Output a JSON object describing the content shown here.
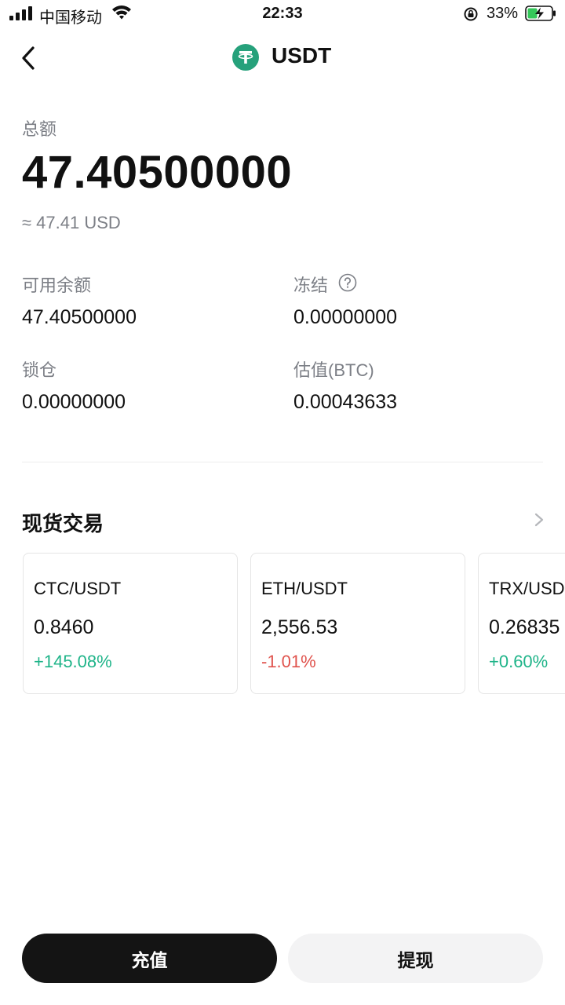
{
  "status_bar": {
    "carrier": "中国移动",
    "time": "22:33",
    "battery": "33%"
  },
  "nav": {
    "title": "USDT",
    "coin_icon": "tether-icon"
  },
  "balance": {
    "total_label": "总额",
    "total_value": "47.40500000",
    "approx_usd": "≈ 47.41 USD",
    "available_label": "可用余额",
    "available_value": "47.40500000",
    "frozen_label": "冻结",
    "frozen_value": "0.00000000",
    "locked_label": "锁仓",
    "locked_value": "0.00000000",
    "estimate_label": "估值(BTC)",
    "estimate_value": "0.00043633"
  },
  "spot": {
    "title": "现货交易",
    "pairs": [
      {
        "pair": "CTC/USDT",
        "price": "0.8460",
        "change": "+145.08%",
        "direction": "up"
      },
      {
        "pair": "ETH/USDT",
        "price": "2,556.53",
        "change": "-1.01%",
        "direction": "down"
      },
      {
        "pair": "TRX/USDT",
        "price": "0.26835",
        "change": "+0.60%",
        "direction": "up"
      }
    ]
  },
  "actions": {
    "deposit": "充值",
    "withdraw": "提现"
  },
  "colors": {
    "up": "#1fb489",
    "down": "#e0534d",
    "coin": "#26a17b",
    "battery_charging": "#34c759"
  }
}
